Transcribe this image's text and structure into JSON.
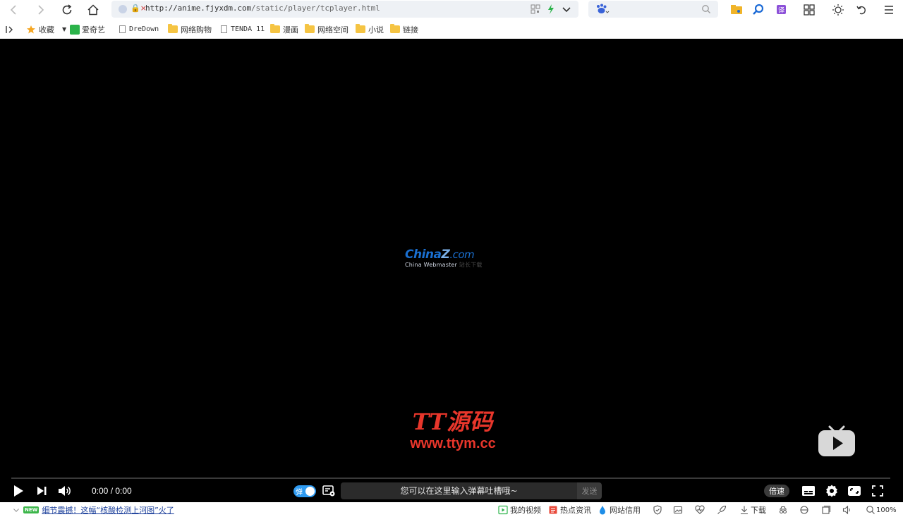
{
  "toolbar": {
    "url_host": "http://anime.fjyxdm.com",
    "url_path": "/static/player/tcplayer.html"
  },
  "bookmarks": {
    "collections": "收藏",
    "items": [
      {
        "label": "爱奇艺",
        "icon": "iqiyi-icon"
      },
      {
        "label": "DreDown",
        "icon": "page-icon"
      },
      {
        "label": "网络购物",
        "icon": "folder-icon"
      },
      {
        "label": "TENDA 11",
        "icon": "page-icon"
      },
      {
        "label": "漫画",
        "icon": "folder-icon"
      },
      {
        "label": "网络空间",
        "icon": "folder-icon"
      },
      {
        "label": "小说",
        "icon": "folder-icon"
      },
      {
        "label": "链接",
        "icon": "folder-icon"
      }
    ]
  },
  "player": {
    "center_logo": {
      "brand_main": "China",
      "brand_z": "Z",
      "brand_com": ".com",
      "sub_en": "China Webmaster",
      "sub_cn": "站长下载"
    },
    "watermark": {
      "line1": "TT源码",
      "line2": "www.ttym.cc"
    },
    "time": "0:00 / 0:00",
    "danmaku_toggle_label": "弹",
    "danmaku_placeholder": "您可以在这里输入弹幕吐槽哦~",
    "send_label": "发送",
    "speed_label": "倍速",
    "progress": 0
  },
  "statusbar": {
    "new_badge": "NEW",
    "news_text": "细节震撼！这幅“核酸检测上河图”火了",
    "items": [
      "我的视频",
      "热点资讯",
      "网站信用"
    ],
    "download": "下载",
    "zoom": "100%"
  },
  "colors": {
    "player_bg": "#000000",
    "watermark_red": "#e8362b",
    "toggle_blue": "#2e9af0",
    "brand_blue": "#1a6fd0"
  }
}
